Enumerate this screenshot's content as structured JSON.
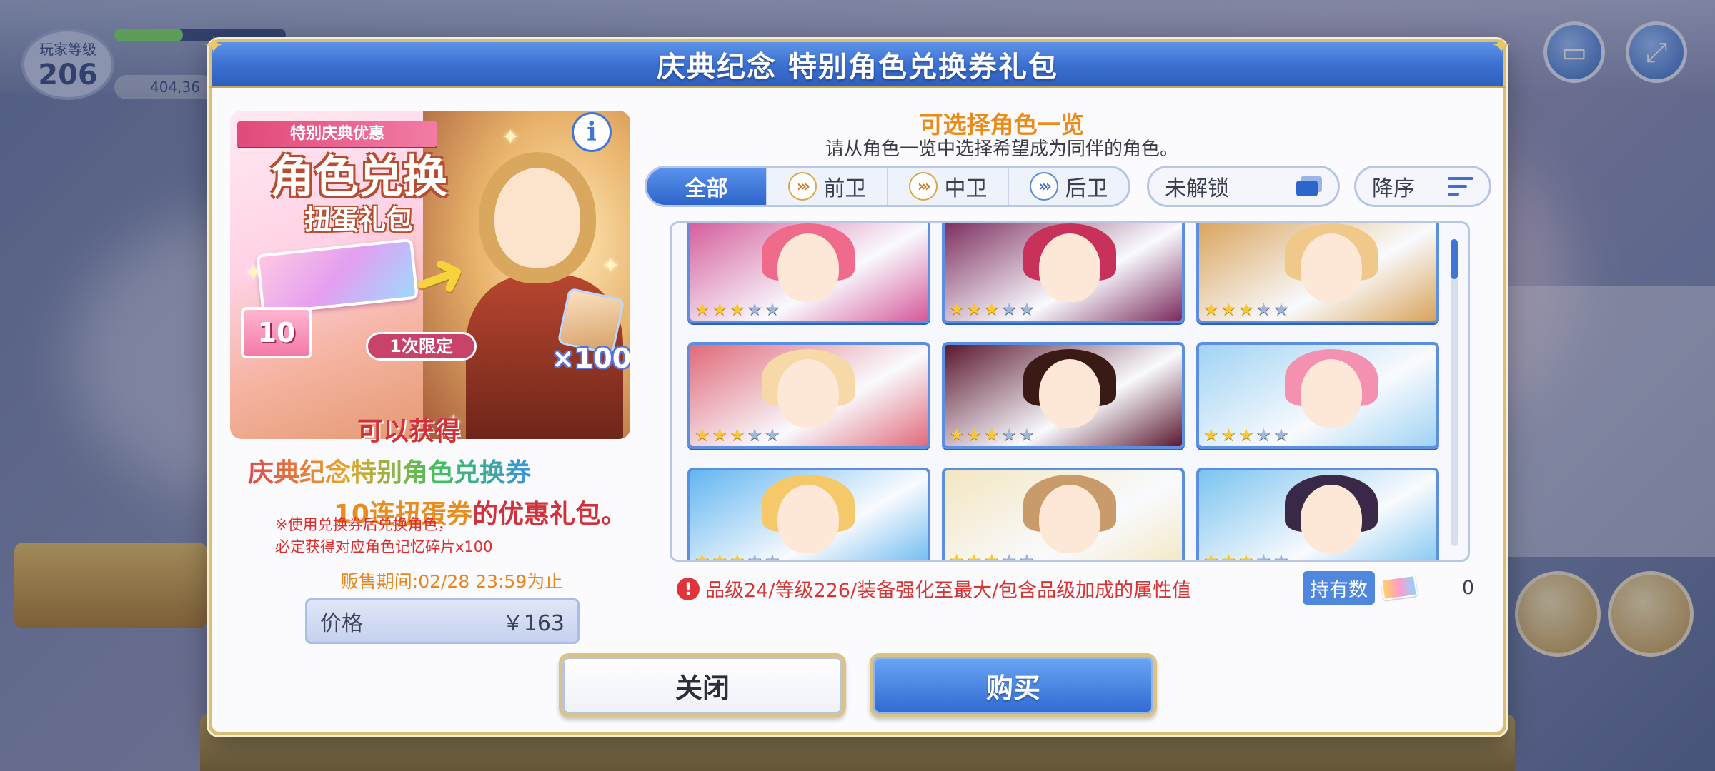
{
  "background": {
    "level_caption": "玩家等级",
    "level": "206",
    "money": "404,36"
  },
  "dialog": {
    "title": "庆典纪念 特别角色兑换券礼包"
  },
  "promo": {
    "ribbon": "特别庆典优惠",
    "headline": "角色兑换",
    "sub": "扭蛋礼包",
    "ticket_count": "10",
    "limit": "1次限定",
    "multiplier": "×100",
    "desc_line1": "可以获得",
    "desc_line2": "庆典纪念特别角色兑换券",
    "desc_line3_hl": "10连扭蛋券",
    "desc_line3_rest": "的优惠礼包。",
    "note_line1": "※使用兑换券后兑换角色，",
    "note_line2": "必定获得对应角色记忆碎片x100",
    "sale_period": "贩售期间:02/28  23:59为止",
    "price_label": "价格",
    "price_value": "￥163"
  },
  "selector": {
    "title": "可选择角色一览",
    "subtitle": "请从角色一览中选择希望成为同伴的角色。",
    "tabs": [
      {
        "label": "全部",
        "active": true
      },
      {
        "label": "前卫",
        "active": false
      },
      {
        "label": "中卫",
        "active": false
      },
      {
        "label": "后卫",
        "active": false
      }
    ],
    "filter_label": "未解锁",
    "sort_label": "降序",
    "characters": [
      {
        "stars": 3,
        "bg": "#d45a9a",
        "hair": "#f06a8c"
      },
      {
        "stars": 3,
        "bg": "#7a2a5c",
        "hair": "#c8325a"
      },
      {
        "stars": 3,
        "bg": "#d9a35a",
        "hair": "#f0c98a"
      },
      {
        "stars": 3,
        "bg": "#e06a7a",
        "hair": "#f7d9a8"
      },
      {
        "stars": 3,
        "bg": "#5a1830",
        "hair": "#3a1a14"
      },
      {
        "stars": 3,
        "bg": "#9fd3f3",
        "hair": "#f591b0"
      },
      {
        "stars": 3,
        "bg": "#63b6f0",
        "hair": "#f5c86a"
      },
      {
        "stars": 3,
        "bg": "#f3e6c0",
        "hair": "#c99a6a"
      },
      {
        "stars": 3,
        "bg": "#7bc4ef",
        "hair": "#3a2848"
      }
    ],
    "max_stars": 5,
    "notice": "品级24/等级226/装备强化至最大/包含品级加成的属性值",
    "holding_label": "持有数",
    "holding_count": "0"
  },
  "buttons": {
    "close": "关闭",
    "buy": "购买"
  }
}
